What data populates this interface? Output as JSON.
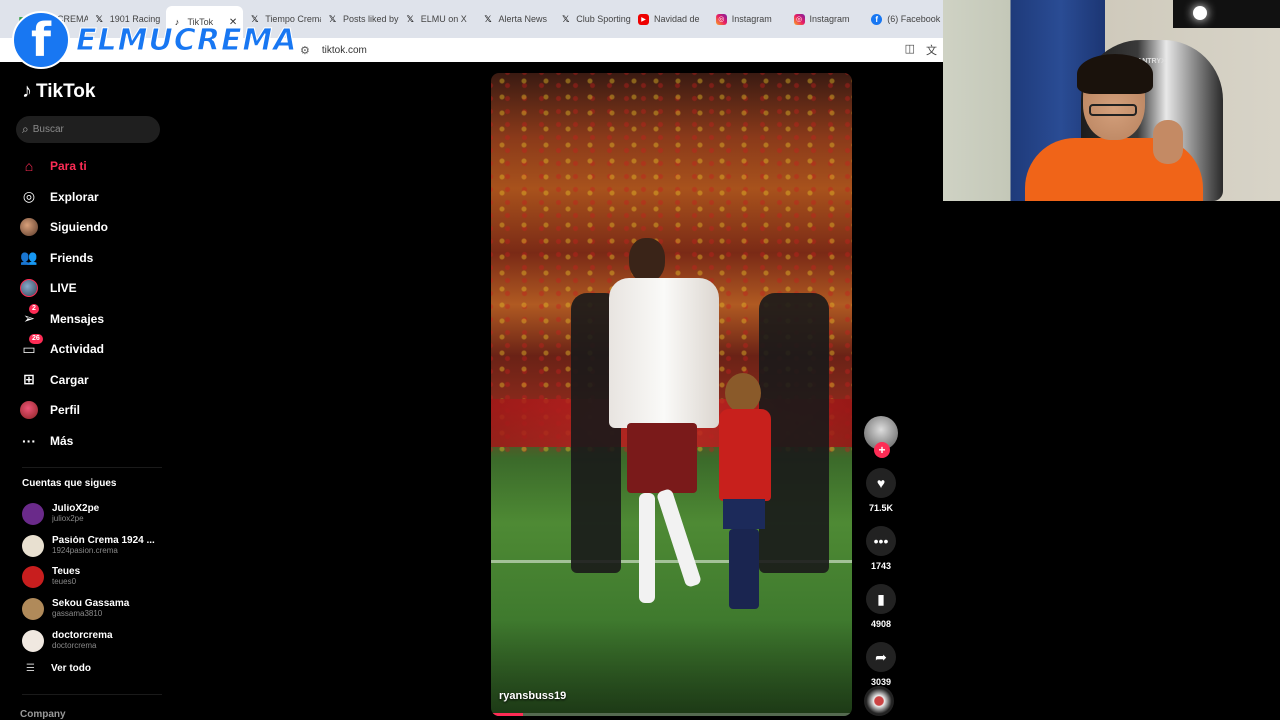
{
  "browser": {
    "tabs": [
      {
        "label": "ELMUCREMA",
        "icon": "green",
        "active": false
      },
      {
        "label": "1901 Racing",
        "icon": "x",
        "active": false
      },
      {
        "label": "TikTok",
        "icon": "tiktok",
        "active": true
      },
      {
        "label": "Tiempo Crema",
        "icon": "x",
        "active": false
      },
      {
        "label": "Posts liked by",
        "icon": "x",
        "active": false
      },
      {
        "label": "ELMU on X",
        "icon": "x",
        "active": false
      },
      {
        "label": "Alerta News",
        "icon": "x",
        "active": false
      },
      {
        "label": "Club Sporting",
        "icon": "x",
        "active": false
      },
      {
        "label": "Navidad de",
        "icon": "youtube",
        "active": false
      },
      {
        "label": "Instagram",
        "icon": "instagram",
        "active": false
      },
      {
        "label": "Instagram",
        "icon": "instagram",
        "active": false
      },
      {
        "label": "(6) Facebook",
        "icon": "facebook",
        "active": false
      }
    ],
    "url": "tiktok.com"
  },
  "overlay": {
    "fb_glyph": "f",
    "channel_name": "ELMUCREMA"
  },
  "sidebar": {
    "brand": "TikTok",
    "search_placeholder": "Buscar",
    "nav": [
      {
        "label": "Para ti",
        "icon": "home-icon",
        "active": true
      },
      {
        "label": "Explorar",
        "icon": "compass-icon"
      },
      {
        "label": "Siguiendo",
        "icon": "following-avatar-icon"
      },
      {
        "label": "Friends",
        "icon": "friends-icon"
      },
      {
        "label": "LIVE",
        "icon": "live-icon"
      },
      {
        "label": "Mensajes",
        "icon": "messages-icon",
        "badge": "2"
      },
      {
        "label": "Actividad",
        "icon": "activity-icon",
        "badge": "26"
      },
      {
        "label": "Cargar",
        "icon": "upload-icon"
      },
      {
        "label": "Perfil",
        "icon": "profile-icon"
      },
      {
        "label": "Más",
        "icon": "more-icon"
      }
    ],
    "following_title": "Cuentas que sigues",
    "following": [
      {
        "name": "JulioX2pe",
        "handle": "juliox2pe",
        "color": "#6a2a8a"
      },
      {
        "name": "Pasión Crema 1924 ...",
        "handle": "1924pasion.crema",
        "color": "#e8e0d0"
      },
      {
        "name": "Teues",
        "handle": "teues0",
        "color": "#c81e1e"
      },
      {
        "name": "Sekou Gassama",
        "handle": "gassama3810",
        "color": "#b08a5a"
      },
      {
        "name": "doctorcrema",
        "handle": "doctorcrema",
        "color": "#f0e8e0"
      }
    ],
    "see_all": "Ver todo",
    "company": "Company"
  },
  "video": {
    "author": "ryansbuss19",
    "progress": 0.09
  },
  "actions": {
    "likes": "71.5K",
    "comments": "1743",
    "saves": "4908",
    "shares": "3039"
  },
  "webcam": {
    "chair_brand": "VANTRYX"
  },
  "colors": {
    "accent": "#fe2c55",
    "facebook": "#1877f2"
  }
}
